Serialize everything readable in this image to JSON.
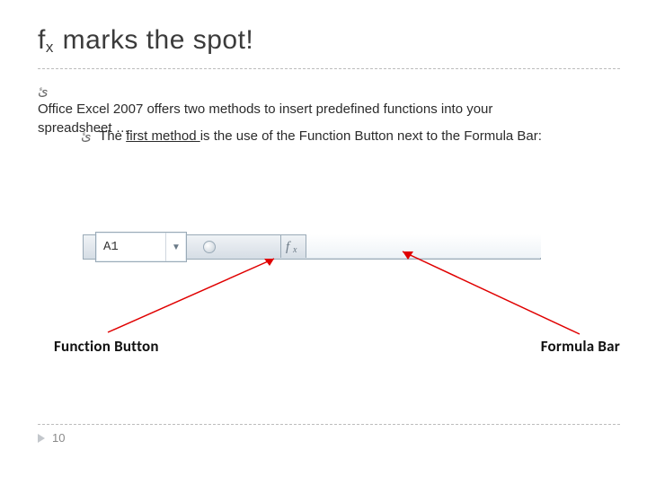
{
  "title": {
    "f": "f",
    "x": "x",
    "rest": " marks the spot!"
  },
  "bullets": {
    "glyph": "ئ",
    "level1": "Office Excel 2007 offers two methods to insert predefined functions into your spreadsheet ….",
    "level2_pre": "The ",
    "level2_underlined": "first method ",
    "level2_post": "is the use of the Function Button next to the Formula Bar:"
  },
  "excel": {
    "namebox": "A1",
    "dropdown_glyph": "▼"
  },
  "labels": {
    "function_button": "Function Button",
    "formula_bar": "Formula Bar"
  },
  "footer": {
    "page": "10"
  }
}
